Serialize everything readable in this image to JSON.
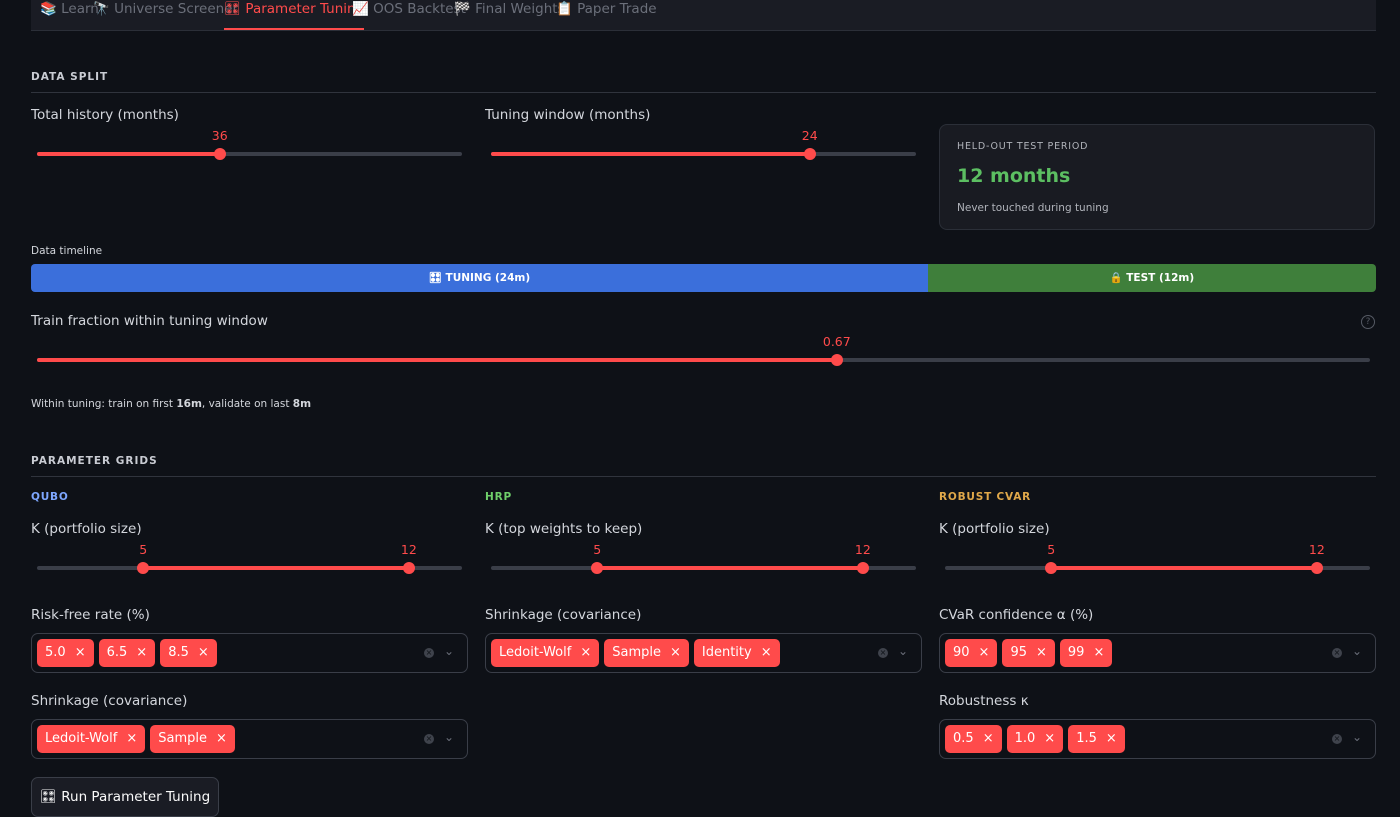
{
  "tabs": [
    {
      "label": "📚 Learn",
      "active": false
    },
    {
      "label": "🔭 Universe Screener",
      "active": false
    },
    {
      "label": "🎛 Parameter Tuning",
      "active": true
    },
    {
      "label": "📈 OOS Backtest",
      "active": false
    },
    {
      "label": "🏁 Final Weights",
      "active": false
    },
    {
      "label": "📋 Paper Trade",
      "active": false
    }
  ],
  "data_split": {
    "title": "DATA SPLIT",
    "total_history": {
      "label": "Total history (months)",
      "value": "36",
      "fraction": 0.43
    },
    "tuning_window": {
      "label": "Tuning window (months)",
      "value": "24",
      "fraction": 0.75
    },
    "held_out": {
      "title": "HELD-OUT TEST PERIOD",
      "value": "12 months",
      "subtitle": "Never touched during tuning"
    },
    "timeline_label": "Data timeline",
    "timeline": [
      {
        "label": "🎛 TUNING (24m)",
        "fraction": 0.6667,
        "color": "#3b6fdb"
      },
      {
        "label": "🔒 TEST (12m)",
        "fraction": 0.3333,
        "color": "#3f7f3b"
      }
    ],
    "train_fraction": {
      "label": "Train fraction within tuning window",
      "value": "0.67",
      "fraction": 0.6
    },
    "note": {
      "prefix": "Within tuning: train on first ",
      "train": "16m",
      "mid": ", validate on last ",
      "validate": "8m"
    }
  },
  "grids": {
    "title": "PARAMETER GRIDS",
    "qubo": {
      "title": "QUBO",
      "color": "#7ea7ff",
      "k": {
        "label": "K (portfolio size)",
        "low": "5",
        "high": "12",
        "low_fraction": 0.25,
        "high_fraction": 0.875
      },
      "rf": {
        "label": "Risk-free rate (%)",
        "chips": [
          "5.0",
          "6.5",
          "8.5"
        ]
      },
      "shrink": {
        "label": "Shrinkage (covariance)",
        "chips": [
          "Ledoit-Wolf",
          "Sample"
        ]
      }
    },
    "hrp": {
      "title": "HRP",
      "color": "#6fcf6a",
      "k": {
        "label": "K (top weights to keep)",
        "low": "5",
        "high": "12",
        "low_fraction": 0.25,
        "high_fraction": 0.875
      },
      "shrink": {
        "label": "Shrinkage (covariance)",
        "chips": [
          "Ledoit-Wolf",
          "Sample",
          "Identity"
        ]
      }
    },
    "cvar": {
      "title": "ROBUST CVAR",
      "color": "#e0a84a",
      "k": {
        "label": "K (portfolio size)",
        "low": "5",
        "high": "12",
        "low_fraction": 0.25,
        "high_fraction": 0.875
      },
      "alpha": {
        "label": "CVaR confidence α (%)",
        "chips": [
          "90",
          "95",
          "99"
        ]
      },
      "kappa": {
        "label": "Robustness κ",
        "chips": [
          "0.5",
          "1.0",
          "1.5"
        ]
      }
    }
  },
  "run_button": "🎛 Run Parameter Tuning",
  "icons": {
    "remove": "close-icon",
    "clear": "clear-icon",
    "dropdown": "chevron-down-icon",
    "help": "help-icon"
  }
}
